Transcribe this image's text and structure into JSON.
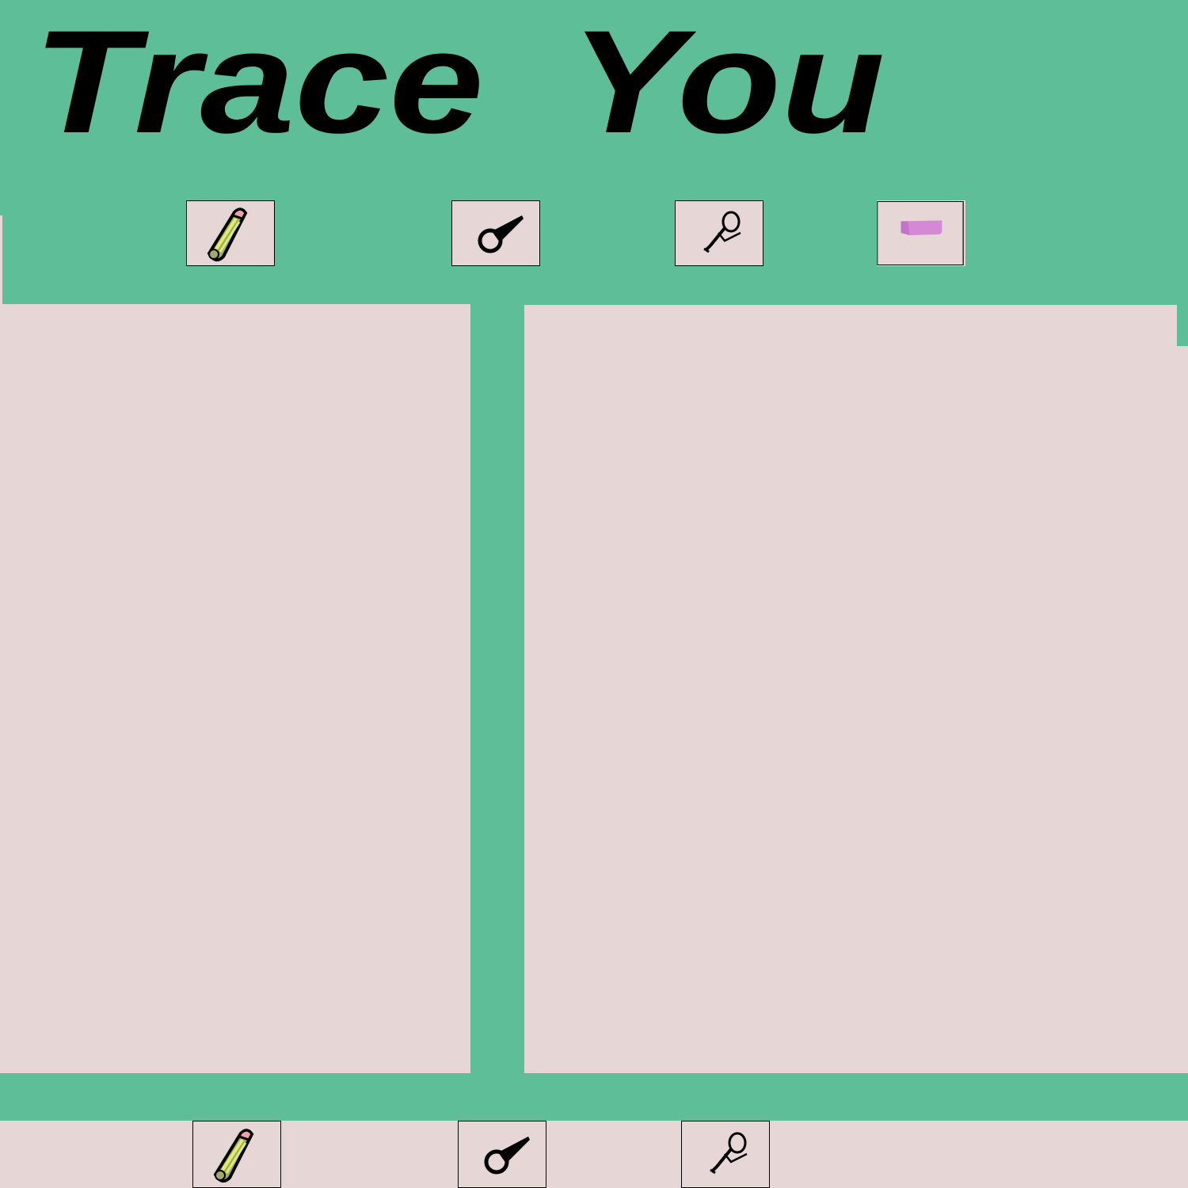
{
  "app": {
    "title_words": [
      "Trace",
      "You"
    ]
  },
  "colors": {
    "frame_green": "#5dbe97",
    "canvas_pink": "#e6d6d6",
    "text": "#000000",
    "eraser_purple": "#d488d6",
    "crayon_pink": "#f0a0a8",
    "crayon_lime": "#dfee6a",
    "crayon_olive": "#a6a86a"
  },
  "top_toolbar": {
    "tools": [
      {
        "name": "crayon",
        "icon": "crayon-icon"
      },
      {
        "name": "brush",
        "icon": "brush-icon"
      },
      {
        "name": "pen",
        "icon": "pen-icon"
      },
      {
        "name": "eraser",
        "icon": "eraser-icon"
      }
    ]
  },
  "bottom_toolbar": {
    "tools": [
      {
        "name": "crayon",
        "icon": "crayon-icon"
      },
      {
        "name": "brush",
        "icon": "brush-icon"
      },
      {
        "name": "pen",
        "icon": "pen-icon"
      }
    ]
  },
  "panels": {
    "left": {
      "name": "reference-canvas",
      "content": ""
    },
    "right": {
      "name": "trace-canvas",
      "content": ""
    }
  }
}
